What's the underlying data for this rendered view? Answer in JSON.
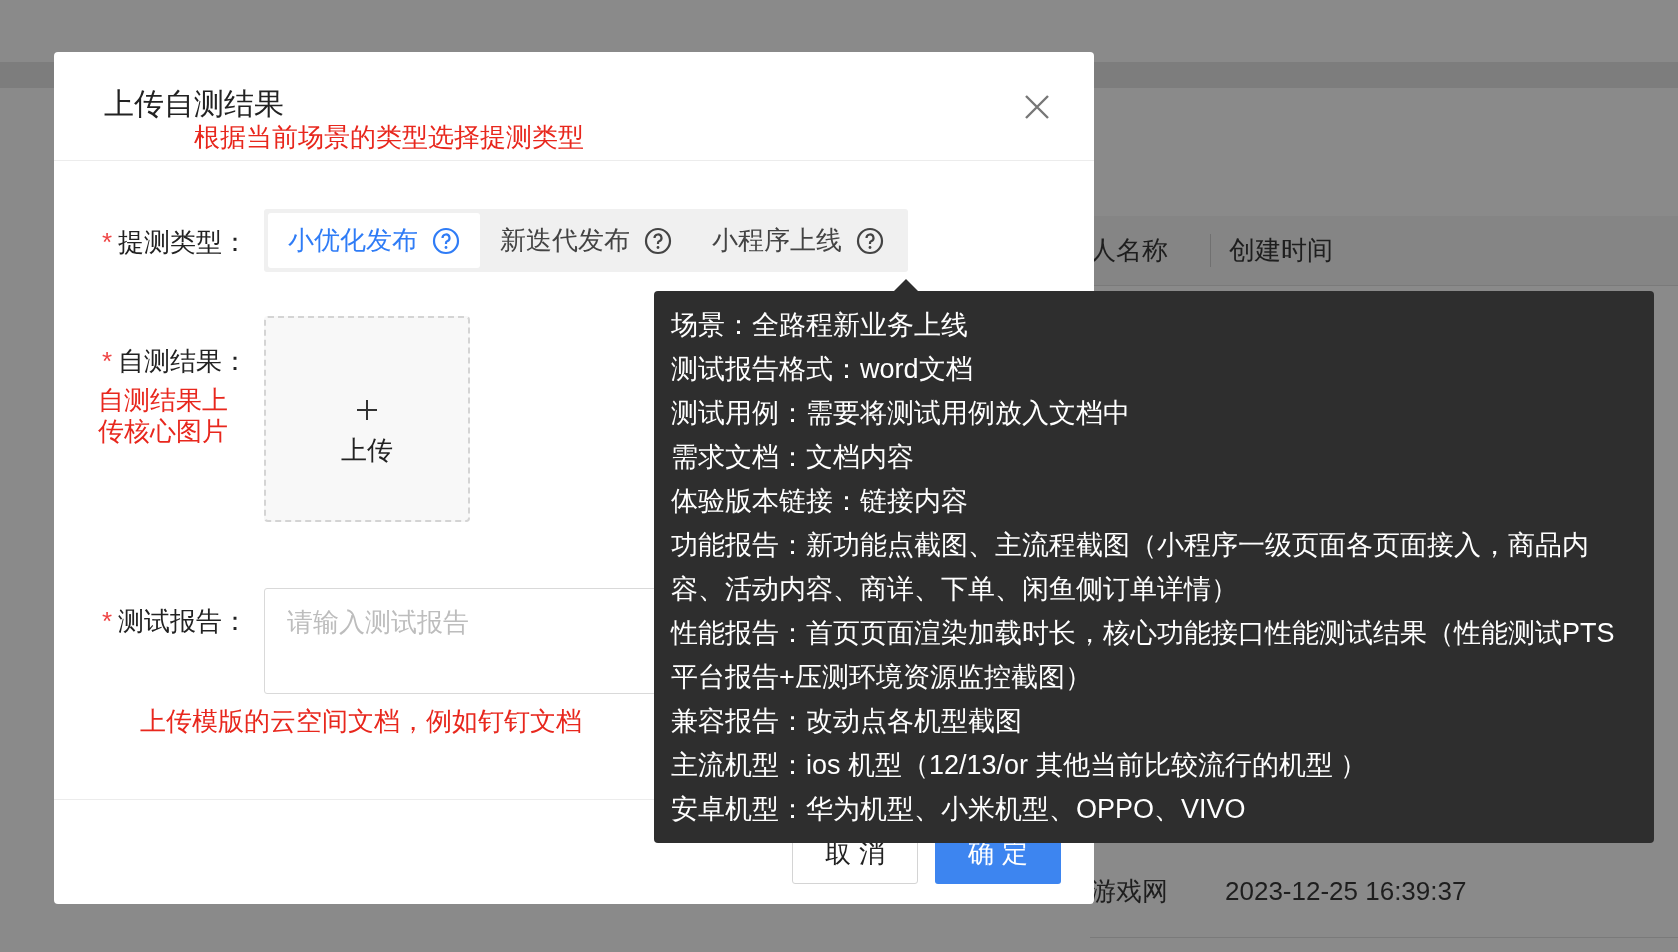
{
  "background": {
    "columns": [
      "人名称",
      "创建时间"
    ],
    "rows": [
      {
        "name": "游戏网",
        "created": "2023-12-25 16:39:37"
      }
    ]
  },
  "dialog": {
    "title": "上传自测结果",
    "annotation": "根据当前场景的类型选择提测类型",
    "fields": [
      {
        "kind": "segmented",
        "required_mark": "*",
        "label": "提测类型：",
        "options": [
          {
            "label": "小优化发布",
            "selected": true
          },
          {
            "label": "新迭代发布",
            "selected": false
          },
          {
            "label": "小程序上线",
            "selected": false
          }
        ]
      },
      {
        "kind": "upload",
        "required_mark": "*",
        "label": "自测结果：",
        "annotation": "自测结果上传核心图片",
        "button": "上传"
      },
      {
        "kind": "textarea",
        "required_mark": "*",
        "label": "测试报告：",
        "placeholder": "请输入测试报告",
        "annotation": "上传模版的云空间文档，例如钉钉文档"
      }
    ],
    "buttons": [
      {
        "label": "取 消",
        "kind": "default"
      },
      {
        "label": "确 定",
        "kind": "primary"
      }
    ]
  },
  "tooltip": {
    "lines": [
      "场景：全路程新业务上线",
      "测试报告格式：word文档",
      "测试用例：需要将测试用例放入文档中",
      "需求文档：文档内容",
      "体验版本链接：链接内容",
      "功能报告：新功能点截图、主流程截图（小程序一级页面各页面接入，商品内",
      "容、活动内容、商详、下单、闲鱼侧订单详情）",
      "性能报告：首页页面渲染加载时长，核心功能接口性能测试结果（性能测试PTS",
      "平台报告+压测环境资源监控截图）",
      "兼容报告：改动点各机型截图",
      "主流机型：ios 机型（12/13/or 其他当前比较流行的机型 ）",
      "安卓机型：华为机型、小米机型、OPPO、VIVO"
    ]
  }
}
